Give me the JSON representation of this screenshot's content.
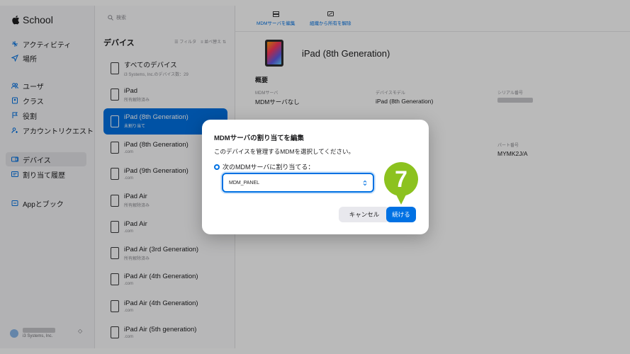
{
  "app": {
    "title": "School"
  },
  "sidebar": {
    "items": [
      {
        "label": "アクティビティ",
        "icon": "activity-icon"
      },
      {
        "label": "場所",
        "icon": "location-arrow-icon"
      },
      {
        "label": "ユーザ",
        "icon": "users-icon"
      },
      {
        "label": "クラス",
        "icon": "class-icon"
      },
      {
        "label": "役割",
        "icon": "flag-icon"
      },
      {
        "label": "アカウントリクエスト",
        "icon": "account-request-icon"
      },
      {
        "label": "デバイス",
        "icon": "devices-icon"
      },
      {
        "label": "割り当て履歴",
        "icon": "history-icon"
      },
      {
        "label": "Appとブック",
        "icon": "apps-books-icon"
      }
    ],
    "active_index": 6,
    "org": {
      "sub": "i3 Systems, Inc."
    }
  },
  "devices": {
    "search_placeholder": "検索",
    "heading": "デバイス",
    "filter_label": "フィルタ",
    "sort_label": "並べ替え",
    "items": [
      {
        "name": "すべてのデバイス",
        "sub": "i3 Systems, Inc.のデバイス数：29"
      },
      {
        "name": "iPad",
        "sub": "所有解除済み"
      },
      {
        "name": "iPad (8th Generation)",
        "sub": "未割り当て"
      },
      {
        "name": "iPad (8th Generation)",
        "sub": ".com"
      },
      {
        "name": "iPad (9th Generation)",
        "sub": ".com"
      },
      {
        "name": "iPad Air",
        "sub": "所有解除済み"
      },
      {
        "name": "iPad Air",
        "sub": ".com"
      },
      {
        "name": "iPad Air (3rd Generation)",
        "sub": "所有解除済み"
      },
      {
        "name": "iPad Air (4th Generation)",
        "sub": ".com"
      },
      {
        "name": "iPad Air (4th Generation)",
        "sub": ".com"
      },
      {
        "name": "iPad Air (5th generation)",
        "sub": ".com"
      }
    ],
    "selected_index": 2
  },
  "detail": {
    "toolbar": {
      "edit_mdm": "MDMサーバを編集",
      "release": "組織から所有を解除"
    },
    "device_title": "iPad (8th Generation)",
    "section": "概要",
    "fields": [
      {
        "key": "MDMサーバ",
        "value": "MDMサーバなし"
      },
      {
        "key": "デバイスモデル",
        "value": "iPad (8th Generation)"
      },
      {
        "key": "シリアル番号",
        "value": ""
      },
      {
        "key": "パート番号",
        "value": "MYMK2J/A"
      }
    ]
  },
  "dialog": {
    "title": "MDMサーバの割り当てを編集",
    "description": "このデバイスを管理するMDMを選択してください。",
    "radio_label": "次のMDMサーバに割り当てる：",
    "selected_server": "MDM_PANEL",
    "cancel_label": "キャンセル",
    "continue_label": "続ける"
  },
  "step_badge": {
    "number": "7",
    "color": "#8cc21f"
  },
  "colors": {
    "accent": "#0071e3"
  }
}
